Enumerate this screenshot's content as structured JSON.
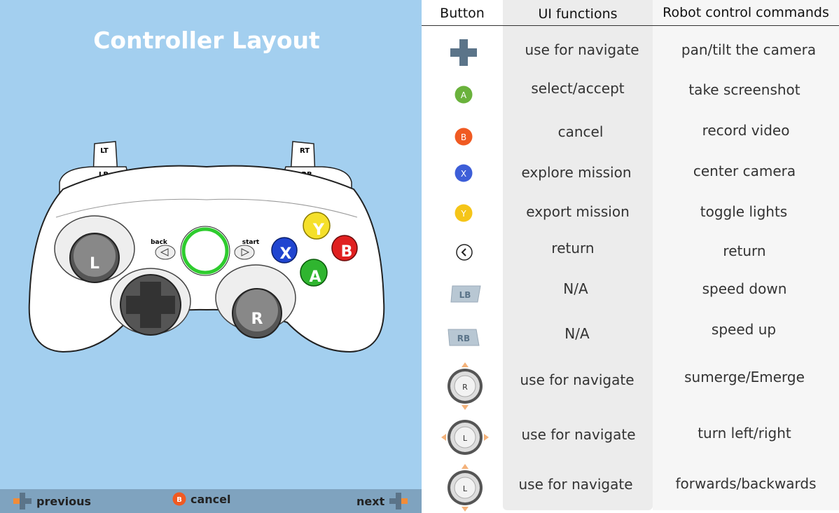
{
  "left_panel": {
    "title": "Controller Layout",
    "controller_labels": {
      "lt": "LT",
      "lb": "LB",
      "rt": "RT",
      "rb": "RB",
      "back": "back",
      "start": "start",
      "left_stick": "L",
      "right_stick": "R",
      "x": "X",
      "y": "Y",
      "a": "A",
      "b": "B"
    },
    "bottom_bar": {
      "previous": "previous",
      "cancel": "cancel",
      "cancel_icon_letter": "B",
      "next": "next"
    }
  },
  "table": {
    "headers": {
      "button": "Button",
      "ui": "UI functions",
      "robot": "Robot control commands"
    },
    "rows": [
      {
        "icon": "dpad-icon",
        "ui": "use for navigate",
        "robot": "pan/tilt the camera"
      },
      {
        "icon": "a-button-icon",
        "letter": "A",
        "color": "#6ab23c",
        "ui": "select/accept",
        "robot": "take screenshot"
      },
      {
        "icon": "b-button-icon",
        "letter": "B",
        "color": "#f05a22",
        "ui": "cancel",
        "robot": "record video"
      },
      {
        "icon": "x-button-icon",
        "letter": "X",
        "color": "#3d5ed8",
        "ui": "explore mission",
        "robot": "center camera"
      },
      {
        "icon": "y-button-icon",
        "letter": "Y",
        "color": "#f5c518",
        "ui": "export mission",
        "robot": "toggle lights"
      },
      {
        "icon": "back-button-icon",
        "ui": "return",
        "robot": "return"
      },
      {
        "icon": "lb-button-icon",
        "letter": "LB",
        "ui": "N/A",
        "robot": "speed down"
      },
      {
        "icon": "rb-button-icon",
        "letter": "RB",
        "ui": "N/A",
        "robot": "speed up"
      },
      {
        "icon": "right-stick-vertical-icon",
        "letter": "R",
        "ui": "use for navigate",
        "robot": "sumerge/Emerge"
      },
      {
        "icon": "left-stick-horizontal-icon",
        "letter": "L",
        "ui": "use for navigate",
        "robot": "turn left/right"
      },
      {
        "icon": "left-stick-vertical-icon",
        "letter": "L",
        "ui": "use for navigate",
        "robot": "forwards/backwards"
      }
    ]
  },
  "colors": {
    "panel_bg": "#a3cfef",
    "bottom_bar_bg": "#7fa3bf",
    "dpad": "#5b7489",
    "arrow_accent": "#f4b27a"
  }
}
